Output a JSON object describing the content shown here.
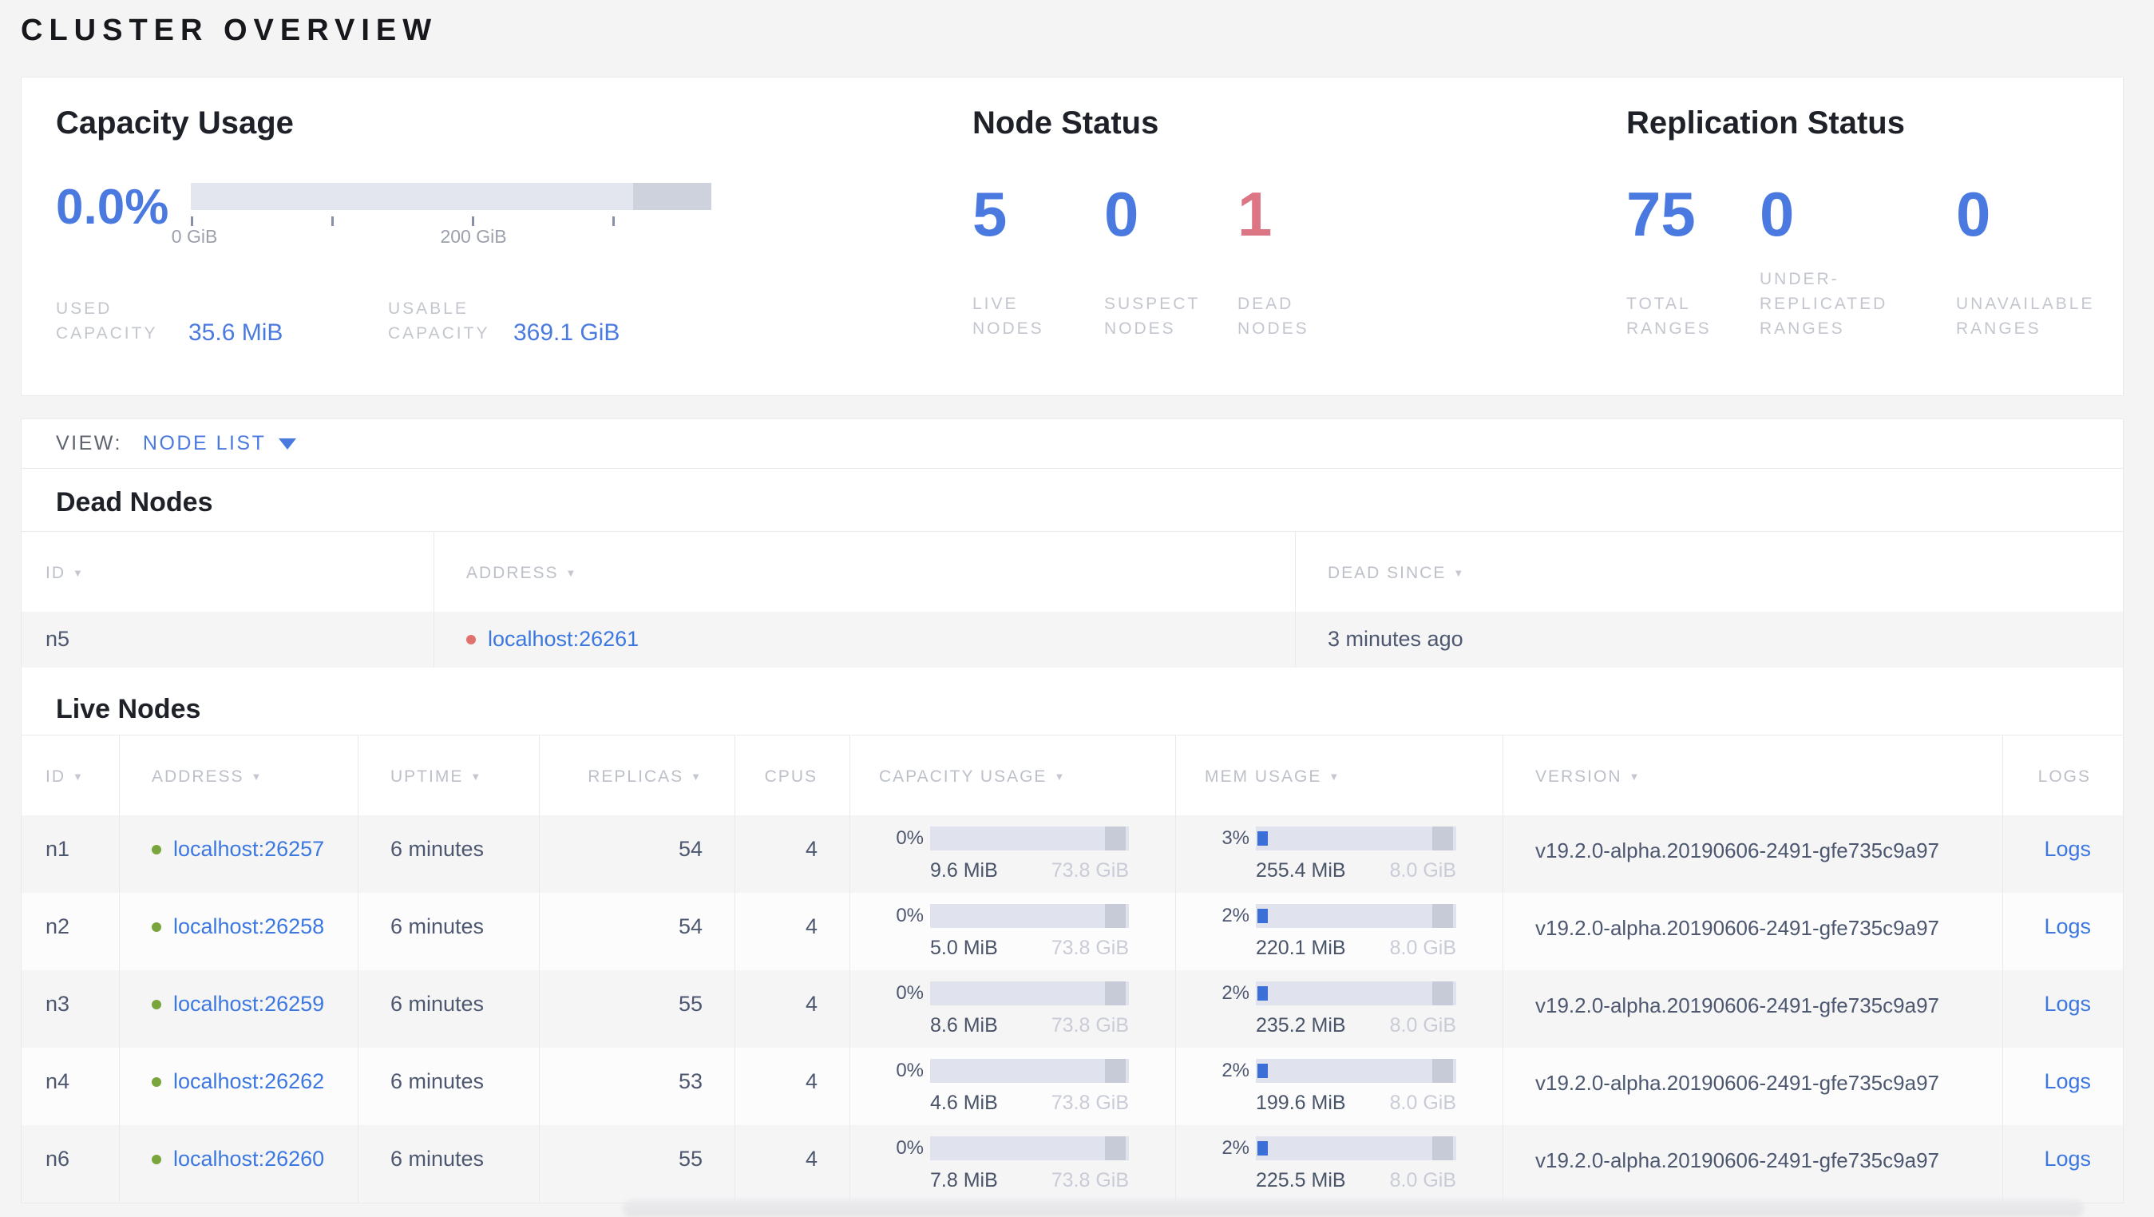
{
  "page": {
    "title": "CLUSTER OVERVIEW"
  },
  "colors": {
    "accent_blue": "#4a7ae0",
    "danger_red": "#dc7684",
    "link_blue": "#3c78e0",
    "live_dot_green": "#7aa53c",
    "dead_dot_red": "#e0716f",
    "bar_track": "#e0e3ed",
    "bar_fill_blue": "#3a6fd8"
  },
  "summary": {
    "capacity": {
      "title": "Capacity Usage",
      "percent": "0.0%",
      "axis": {
        "tick0_label": "0 GiB",
        "tick200_label": "200 GiB"
      },
      "used": {
        "l1": "USED",
        "l2": "CAPACITY",
        "value": "35.6 MiB"
      },
      "usable": {
        "l1": "USABLE",
        "l2": "CAPACITY",
        "value": "369.1 GiB"
      }
    },
    "node_status": {
      "title": "Node Status",
      "live": {
        "value": "5",
        "l1": "LIVE",
        "l2": "NODES"
      },
      "suspect": {
        "value": "0",
        "l1": "SUSPECT",
        "l2": "NODES"
      },
      "dead": {
        "value": "1",
        "l1": "DEAD",
        "l2": "NODES"
      }
    },
    "replication": {
      "title": "Replication Status",
      "total": {
        "value": "75",
        "l1": "TOTAL",
        "l2": "RANGES"
      },
      "under": {
        "value": "0",
        "l1": "UNDER-",
        "l2": "REPLICATED",
        "l3": "RANGES"
      },
      "unavailable": {
        "value": "0",
        "l1": "UNAVAILABLE",
        "l2": "RANGES"
      }
    }
  },
  "view_bar": {
    "label": "VIEW:",
    "selected": "NODE LIST"
  },
  "dead_nodes": {
    "title": "Dead Nodes",
    "columns": {
      "id": "ID",
      "address": "ADDRESS",
      "dead_since": "DEAD SINCE"
    },
    "rows": [
      {
        "id": "n5",
        "address": "localhost:26261",
        "dead_since": "3 minutes ago"
      }
    ]
  },
  "live_nodes": {
    "title": "Live Nodes",
    "columns": {
      "id": "ID",
      "address": "ADDRESS",
      "uptime": "UPTIME",
      "replicas": "REPLICAS",
      "cpus": "CPUS",
      "capacity": "CAPACITY USAGE",
      "mem": "MEM USAGE",
      "version": "VERSION",
      "logs": "LOGS"
    },
    "rows": [
      {
        "id": "n1",
        "address": "localhost:26257",
        "uptime": "6 minutes",
        "replicas": "54",
        "cpus": "4",
        "capacity": {
          "percent_label": "0%",
          "fill": 0,
          "used": "9.6 MiB",
          "total": "73.8 GiB"
        },
        "mem": {
          "percent_label": "3%",
          "fill": 3,
          "used": "255.4 MiB",
          "total": "8.0 GiB"
        },
        "version": "v19.2.0-alpha.20190606-2491-gfe735c9a97",
        "logs": "Logs"
      },
      {
        "id": "n2",
        "address": "localhost:26258",
        "uptime": "6 minutes",
        "replicas": "54",
        "cpus": "4",
        "capacity": {
          "percent_label": "0%",
          "fill": 0,
          "used": "5.0 MiB",
          "total": "73.8 GiB"
        },
        "mem": {
          "percent_label": "2%",
          "fill": 2,
          "used": "220.1 MiB",
          "total": "8.0 GiB"
        },
        "version": "v19.2.0-alpha.20190606-2491-gfe735c9a97",
        "logs": "Logs"
      },
      {
        "id": "n3",
        "address": "localhost:26259",
        "uptime": "6 minutes",
        "replicas": "55",
        "cpus": "4",
        "capacity": {
          "percent_label": "0%",
          "fill": 0,
          "used": "8.6 MiB",
          "total": "73.8 GiB"
        },
        "mem": {
          "percent_label": "2%",
          "fill": 2,
          "used": "235.2 MiB",
          "total": "8.0 GiB"
        },
        "version": "v19.2.0-alpha.20190606-2491-gfe735c9a97",
        "logs": "Logs"
      },
      {
        "id": "n4",
        "address": "localhost:26262",
        "uptime": "6 minutes",
        "replicas": "53",
        "cpus": "4",
        "capacity": {
          "percent_label": "0%",
          "fill": 0,
          "used": "4.6 MiB",
          "total": "73.8 GiB"
        },
        "mem": {
          "percent_label": "2%",
          "fill": 2,
          "used": "199.6 MiB",
          "total": "8.0 GiB"
        },
        "version": "v19.2.0-alpha.20190606-2491-gfe735c9a97",
        "logs": "Logs"
      },
      {
        "id": "n6",
        "address": "localhost:26260",
        "uptime": "6 minutes",
        "replicas": "55",
        "cpus": "4",
        "capacity": {
          "percent_label": "0%",
          "fill": 0,
          "used": "7.8 MiB",
          "total": "73.8 GiB"
        },
        "mem": {
          "percent_label": "2%",
          "fill": 2,
          "used": "225.5 MiB",
          "total": "8.0 GiB"
        },
        "version": "v19.2.0-alpha.20190606-2491-gfe735c9a97",
        "logs": "Logs"
      }
    ]
  }
}
